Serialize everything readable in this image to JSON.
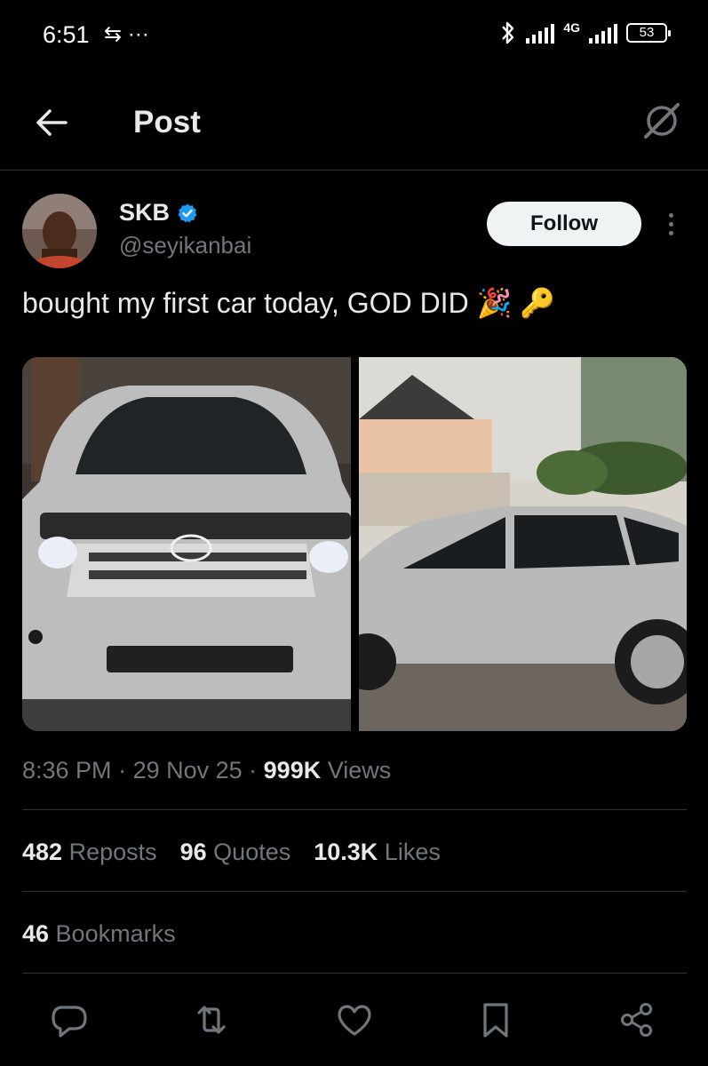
{
  "status_bar": {
    "time": "6:51",
    "left_icons": "⇆ ···",
    "network": "4G",
    "battery": "53"
  },
  "header": {
    "title": "Post"
  },
  "author": {
    "name": "SKB",
    "handle": "@seyikanbai",
    "follow_label": "Follow"
  },
  "tweet": {
    "text": "bought my first car today, GOD DID 🎉 🔑"
  },
  "meta": {
    "time": "8:36 PM",
    "sep1": " · ",
    "date": "29 Nov 25",
    "sep2": " · ",
    "views_count": "999K",
    "views_label": " Views"
  },
  "stats": {
    "reposts_count": "482",
    "reposts_label": " Reposts",
    "quotes_count": "96",
    "quotes_label": " Quotes",
    "likes_count": "10.3K",
    "likes_label": " Likes",
    "bookmarks_count": "46",
    "bookmarks_label": " Bookmarks"
  },
  "colors": {
    "background": "#000000",
    "text": "#e7e9ea",
    "secondary": "#71767b",
    "verified": "#1d9bf0",
    "divider": "#2f3336"
  },
  "icons": {
    "back": "arrow-left-icon",
    "grok": "grok-icon",
    "reply": "reply-icon",
    "repost": "repost-icon",
    "like": "heart-icon",
    "bookmark": "bookmark-icon",
    "share": "share-icon"
  }
}
